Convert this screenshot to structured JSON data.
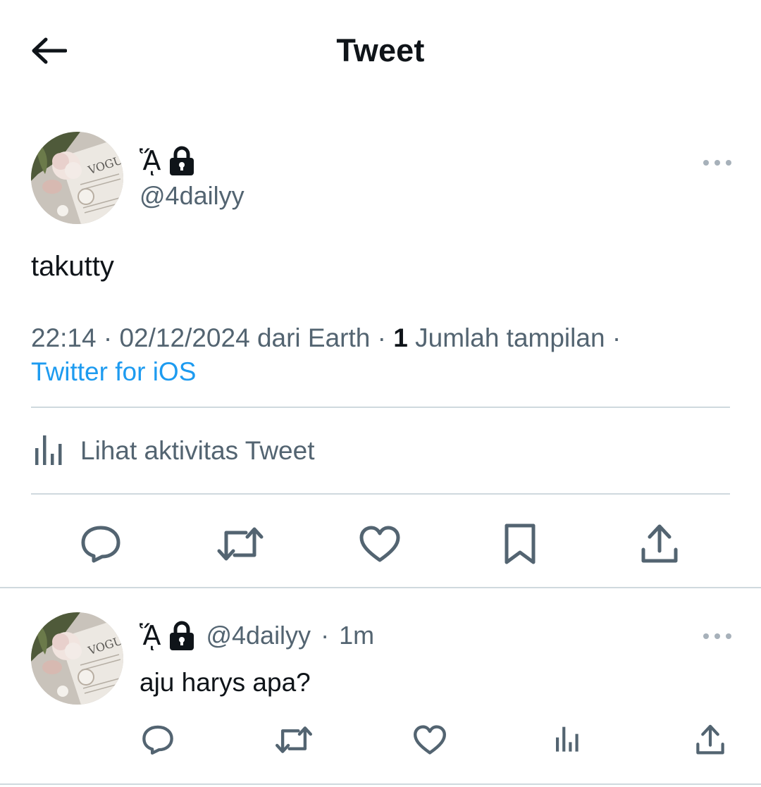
{
  "header": {
    "title": "Tweet",
    "back_icon": "arrow-left-icon"
  },
  "tweet": {
    "display_name_glyph": "ᾍ",
    "display_name_glyph_text": "ᾍ",
    "handle": "@4dailyy",
    "text": "takutty",
    "time": "22:14",
    "date": "02/12/2024",
    "location_text": "dari Earth",
    "separator": "·",
    "views_count": "1",
    "views_label": "Jumlah tampilan",
    "source": "Twitter for iOS",
    "activity_label": "Lihat aktivitas Tweet",
    "source_color": "#1d9bf0"
  },
  "actions": [
    "reply-icon",
    "retweet-icon",
    "like-icon",
    "bookmark-icon",
    "share-icon"
  ],
  "reply": {
    "display_name_glyph_text": "ᾍ",
    "handle": "@4dailyy",
    "separator": "·",
    "time": "1m",
    "text": "aju harys apa?",
    "actions": [
      "reply-icon",
      "retweet-icon",
      "like-icon",
      "views-icon",
      "share-icon"
    ]
  },
  "colors": {
    "text_primary": "#0f1419",
    "text_secondary": "#536471",
    "accent": "#1d9bf0",
    "divider": "#cfd9de"
  }
}
